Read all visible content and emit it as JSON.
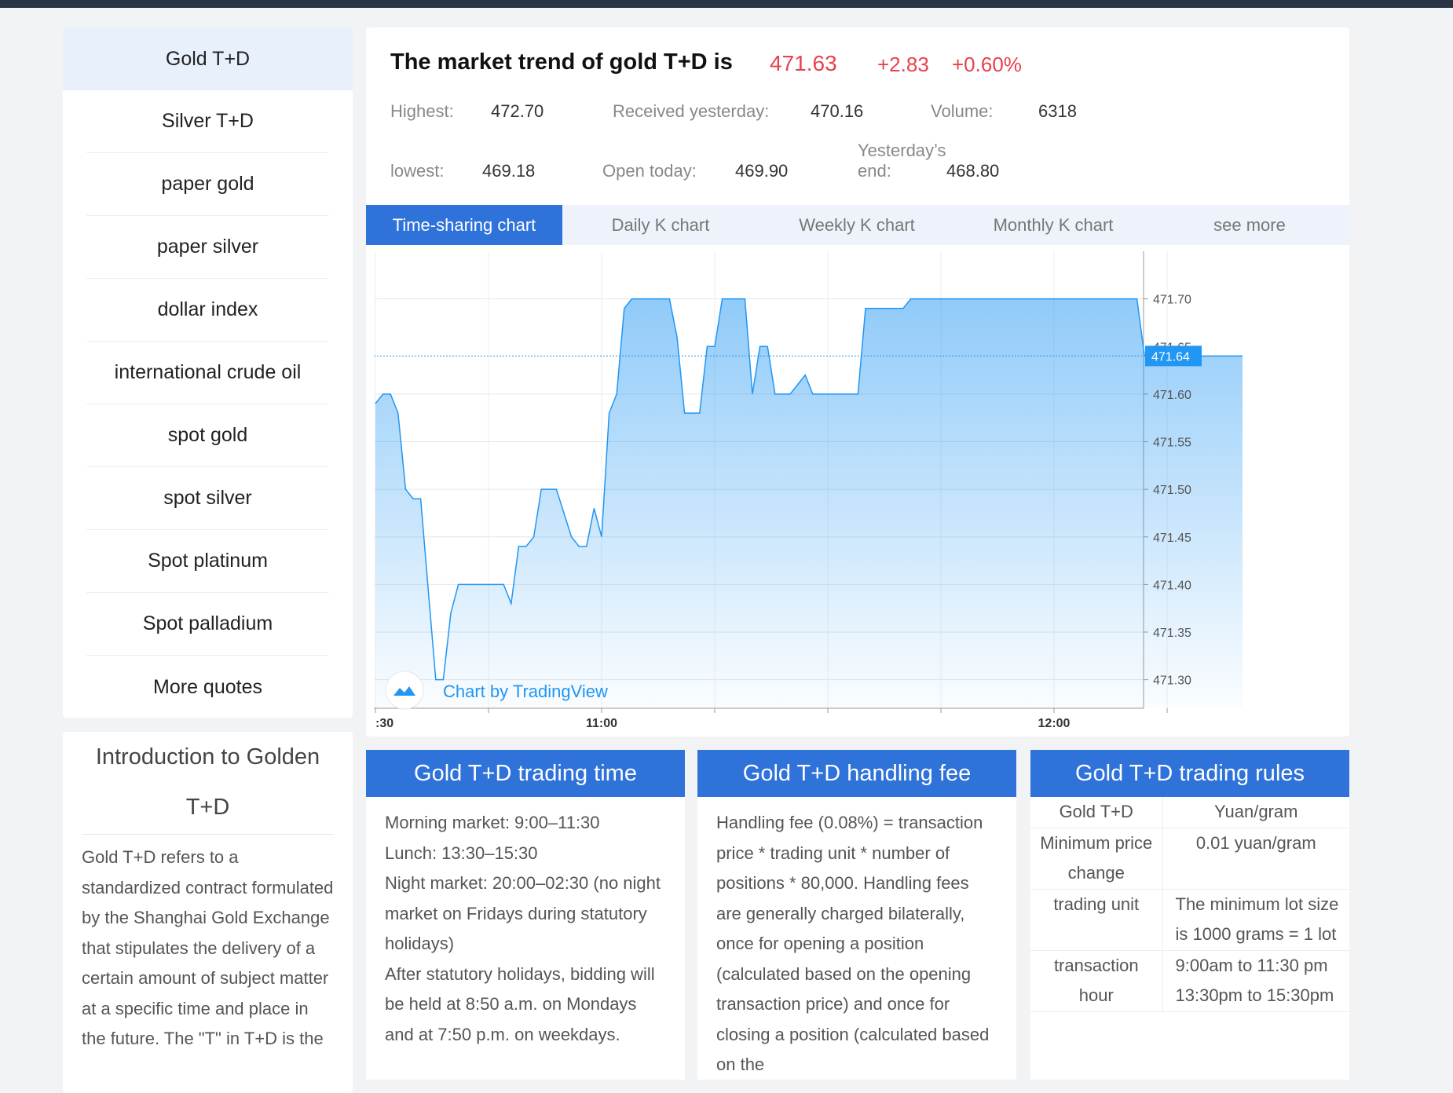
{
  "sidebar": {
    "items": [
      {
        "label": "Gold T+D",
        "active": true
      },
      {
        "label": "Silver T+D"
      },
      {
        "label": "paper gold"
      },
      {
        "label": "paper silver"
      },
      {
        "label": "dollar index"
      },
      {
        "label": "international crude oil"
      },
      {
        "label": "spot gold"
      },
      {
        "label": "spot silver"
      },
      {
        "label": "Spot platinum"
      },
      {
        "label": "Spot palladium"
      },
      {
        "label": "More quotes"
      }
    ]
  },
  "intro": {
    "title": "Introduction to Golden T+D",
    "body": "Gold T+D refers to a standardized contract formulated by the Shanghai Gold Exchange that stipulates the delivery of a certain amount of subject matter at a specific time and place in the future. The \"T\" in T+D is the"
  },
  "quote": {
    "title": "The market trend of gold T+D is",
    "price": "471.63",
    "change": "+2.83",
    "change_pct": "+0.60%",
    "highest_label": "Highest:",
    "highest": "472.70",
    "received_label": "Received yesterday:",
    "received": "470.16",
    "volume_label": "Volume:",
    "volume": "6318",
    "lowest_label": "lowest:",
    "lowest": "469.18",
    "open_label": "Open today:",
    "open": "469.90",
    "yend_label_1": "Yesterday’s",
    "yend_label_2": "end:",
    "yend": "468.80",
    "accent": "#e8414d"
  },
  "tabs": [
    {
      "label": "Time-sharing chart",
      "active": true
    },
    {
      "label": "Daily K chart"
    },
    {
      "label": "Weekly K chart"
    },
    {
      "label": "Monthly K chart"
    },
    {
      "label": "see more"
    }
  ],
  "chart_data": {
    "type": "area",
    "attribution": "Chart by TradingView",
    "x_tick_labels": [
      ":30",
      "11:00",
      "12:00"
    ],
    "y_ticks": [
      471.7,
      471.6,
      471.55,
      471.5,
      471.45,
      471.4,
      471.35,
      471.3
    ],
    "ylim": [
      471.27,
      471.75
    ],
    "last_price_label": "471.64",
    "hidden_tick_label": "471.65",
    "grid": true,
    "color": "#2196f3",
    "x": [
      "10:30",
      "10:31",
      "10:32",
      "10:33",
      "10:34",
      "10:35",
      "10:36",
      "10:38",
      "10:39",
      "10:40",
      "10:41",
      "10:47",
      "10:48",
      "10:49",
      "10:50",
      "10:51",
      "10:52",
      "10:54",
      "10:56",
      "10:57",
      "10:58",
      "10:59",
      "11:00",
      "11:01",
      "11:02",
      "11:03",
      "11:04",
      "11:09",
      "11:10",
      "11:11",
      "11:13",
      "11:14",
      "11:15",
      "11:16",
      "11:19",
      "11:20",
      "11:21",
      "11:22",
      "11:23",
      "11:25",
      "11:27",
      "11:28",
      "11:34",
      "11:35",
      "11:40",
      "11:41",
      "12:11",
      "12:12",
      "12:25"
    ],
    "values": [
      471.59,
      471.6,
      471.6,
      471.58,
      471.5,
      471.49,
      471.49,
      471.3,
      471.3,
      471.37,
      471.4,
      471.4,
      471.38,
      471.44,
      471.44,
      471.45,
      471.5,
      471.5,
      471.45,
      471.44,
      471.44,
      471.48,
      471.45,
      471.58,
      471.6,
      471.69,
      471.7,
      471.7,
      471.66,
      471.58,
      471.58,
      471.65,
      471.65,
      471.7,
      471.7,
      471.6,
      471.65,
      471.65,
      471.6,
      471.6,
      471.62,
      471.6,
      471.6,
      471.69,
      471.69,
      471.7,
      471.7,
      471.64,
      471.64
    ]
  },
  "cards": {
    "time": {
      "title": "Gold T+D trading time",
      "lines": [
        "Morning market: 9:00–11:30",
        "Lunch: 13:30–15:30",
        "Night market: 20:00–02:30 (no night market on Fridays during statutory holidays)",
        "After statutory holidays, bidding will be held at 8:50 a.m. on Mondays and at 7:50 p.m. on weekdays."
      ]
    },
    "fee": {
      "title": "Gold T+D handling fee",
      "text": "Handling fee (0.08%) = transaction price * trading unit * number of positions * 80,000. Handling fees are generally charged bilaterally, once for opening a position (calculated based on the opening transaction price) and once for closing a position (calculated based on the"
    },
    "rules": {
      "title": "Gold T+D trading rules",
      "rows": [
        [
          "Gold T+D",
          "Yuan/gram"
        ],
        [
          "Minimum price change",
          "0.01 yuan/gram"
        ],
        [
          "trading unit",
          "The minimum lot size is 1000 grams = 1 lot"
        ],
        [
          "transaction hour",
          "9:00am to 11:30 pm 13:30pm to 15:30pm"
        ]
      ]
    }
  }
}
